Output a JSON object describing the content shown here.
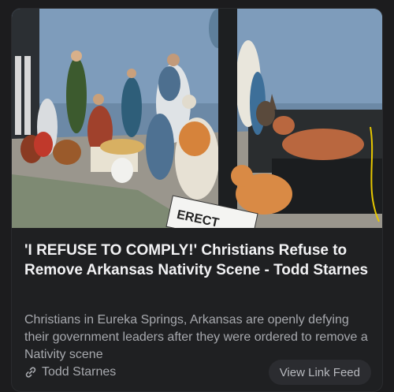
{
  "post": {
    "title": "'I REFUSE TO COMPLY!' Christians Refuse to Remove Arkansas Nativity Scene - Todd Starnes",
    "description": "Christians in Eureka Springs, Arkansas are openly defying their government leaders after they were ordered to remove a Nativity scene",
    "source_name": "Todd Starnes",
    "action_label": "View Link Feed",
    "image_sign_text": "ERECT"
  },
  "icons": {
    "source": "link-icon"
  },
  "colors": {
    "background": "#1c1c1e",
    "card": "#1f2022",
    "title": "#f2f2f4",
    "muted_text": "#a7a9ae",
    "button": "#2b2c30"
  }
}
